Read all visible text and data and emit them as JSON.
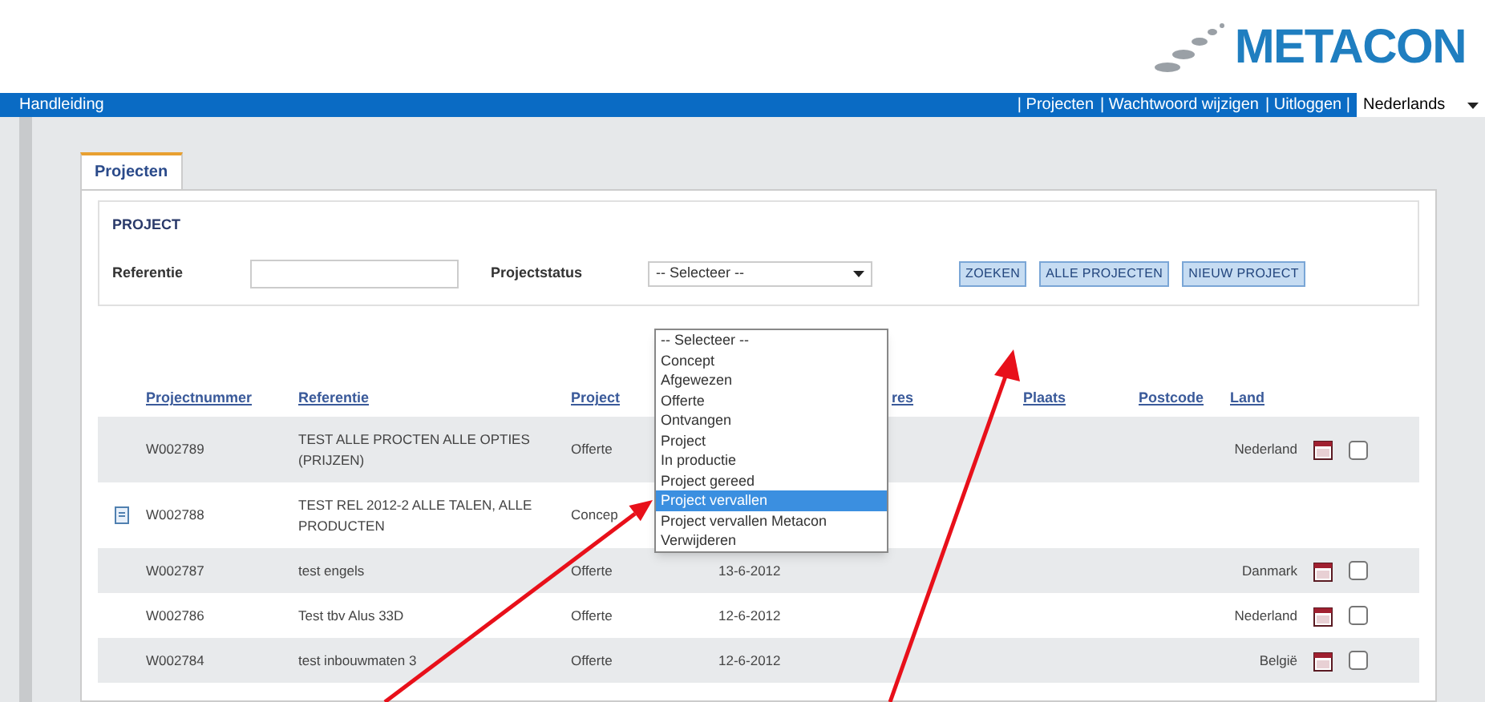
{
  "logo": {
    "text": "METACON"
  },
  "nav": {
    "left": "Handleiding",
    "links": [
      "| Projecten",
      "| Wachtwoord wijzigen",
      "| Uitloggen |"
    ],
    "language": "Nederlands"
  },
  "tabs": [
    {
      "label": "Projecten",
      "selected": true
    }
  ],
  "search": {
    "title": "PROJECT",
    "reference_label": "Referentie",
    "status_label": "Projectstatus",
    "status_value": "-- Selecteer --",
    "status_options": [
      {
        "label": "-- Selecteer --",
        "selected": false
      },
      {
        "label": "Concept",
        "selected": false
      },
      {
        "label": "Afgewezen",
        "selected": false
      },
      {
        "label": "Offerte",
        "selected": false
      },
      {
        "label": "Ontvangen",
        "selected": false
      },
      {
        "label": "Project",
        "selected": false
      },
      {
        "label": "In productie",
        "selected": false
      },
      {
        "label": "Project gereed",
        "selected": false
      },
      {
        "label": "Project vervallen",
        "selected": true
      },
      {
        "label": "Project vervallen Metacon",
        "selected": false
      },
      {
        "label": "Verwijderen",
        "selected": false
      }
    ],
    "buttons": [
      "ZOEKEN",
      "ALLE PROJECTEN",
      "NIEUW PROJECT"
    ]
  },
  "table": {
    "columns": [
      "Projectnummer",
      "Referentie",
      "Project",
      "res",
      "Plaats",
      "Postcode",
      "Land"
    ],
    "rows": [
      {
        "number": "W002789",
        "reference": "TEST ALLE PROCTEN ALLE OPTIES (PRIJZEN)",
        "status": "Offerte",
        "land": "Nederland",
        "document": false,
        "actions": true,
        "checked": false
      },
      {
        "number": "W002788",
        "reference": "TEST REL 2012-2 ALLE TALEN, ALLE PRODUCTEN",
        "status": "Concep",
        "document": true,
        "actions": false
      },
      {
        "number": "W002787",
        "reference": "test engels",
        "status": "Offerte",
        "date": "13-6-2012",
        "land": "Danmark",
        "document": false,
        "actions": true,
        "checked": false
      },
      {
        "number": "W002786",
        "reference": "Test tbv Alus 33D",
        "status": "Offerte",
        "date": "12-6-2012",
        "land": "Nederland",
        "document": false,
        "actions": true,
        "checked": false
      },
      {
        "number": "W002784",
        "reference": "test inbouwmaten 3",
        "status": "Offerte",
        "date": "12-6-2012",
        "land": "België",
        "document": false,
        "actions": true,
        "checked": false
      }
    ]
  }
}
